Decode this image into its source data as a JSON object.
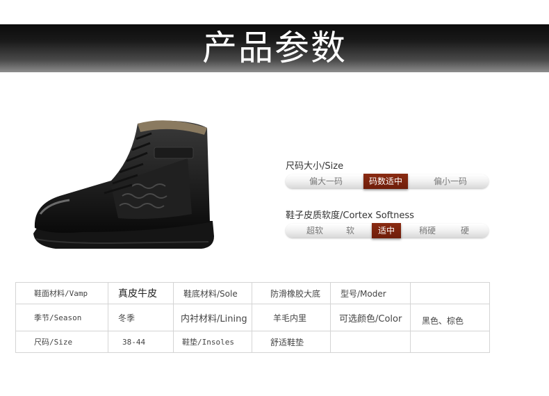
{
  "header": {
    "title": "产品参数"
  },
  "indicators": [
    {
      "title": "尺码大小/Size",
      "options": [
        "偏大一码",
        "码数适中",
        "偏小一码"
      ],
      "selected_index": 1
    },
    {
      "title": "鞋子皮质软度/Cortex Softness",
      "options": [
        "超软",
        "软",
        "适中",
        "稍硬",
        "硬"
      ],
      "selected_index": 2
    }
  ],
  "specs": {
    "row1": [
      "鞋面材料/Vamp",
      "真皮牛皮",
      "鞋底材料/Sole",
      "防滑橡胶大底",
      "型号/Moder",
      ""
    ],
    "row2": [
      "季节/Season",
      "冬季",
      "内衬材料/Lining",
      "羊毛内里",
      "可选颜色/Color",
      "黑色、棕色"
    ],
    "row3": [
      "尺码/Size",
      "38-44",
      "鞋垫/Insoles",
      "舒适鞋垫",
      "",
      ""
    ]
  },
  "colors": {
    "active": "#7a220d",
    "header_dark": "#0c0c0c"
  }
}
